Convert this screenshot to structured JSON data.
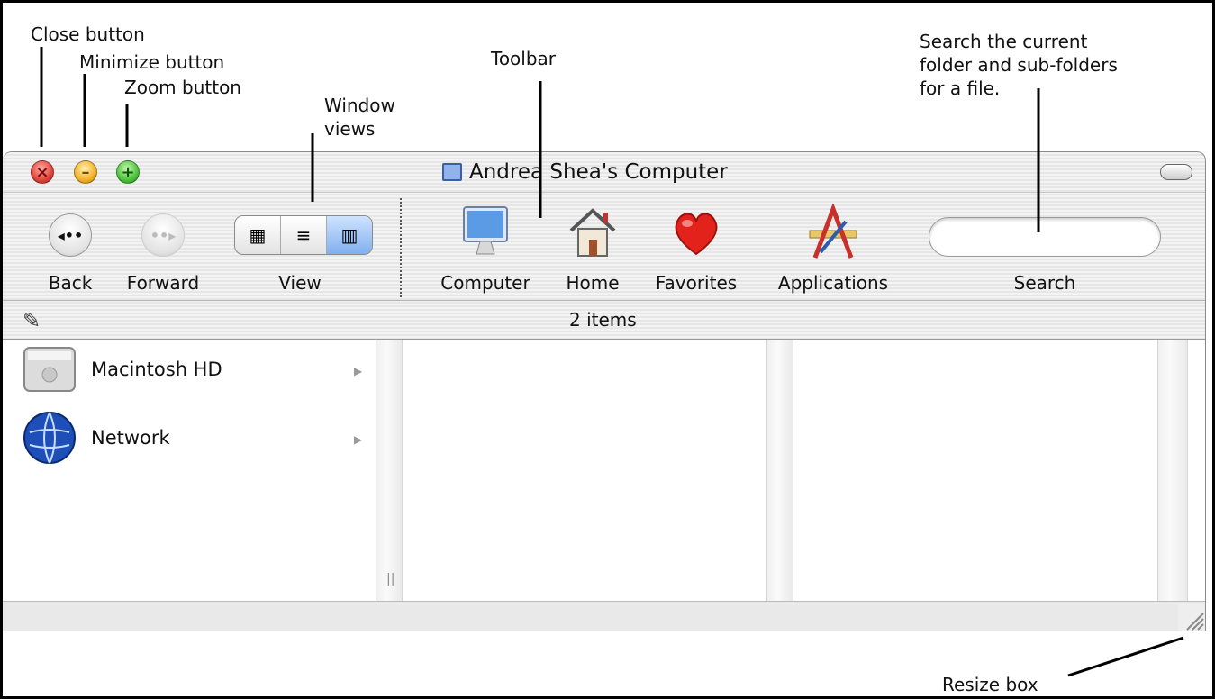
{
  "annotations": {
    "close": "Close button",
    "minimize": "Minimize button",
    "zoom": "Zoom button",
    "window_views": "Window\nviews",
    "toolbar": "Toolbar",
    "search_desc": "Search the current\nfolder and sub-folders\nfor a file.",
    "resize": "Resize box"
  },
  "window": {
    "title": "Andrea Shea's Computer",
    "toolbar": {
      "back": "Back",
      "forward": "Forward",
      "view": "View",
      "computer": "Computer",
      "home": "Home",
      "favorites": "Favorites",
      "applications": "Applications",
      "search": "Search"
    },
    "status": "2 items",
    "items": [
      {
        "label": "Macintosh HD",
        "icon": "hard-drive-icon"
      },
      {
        "label": "Network",
        "icon": "globe-icon"
      }
    ]
  }
}
